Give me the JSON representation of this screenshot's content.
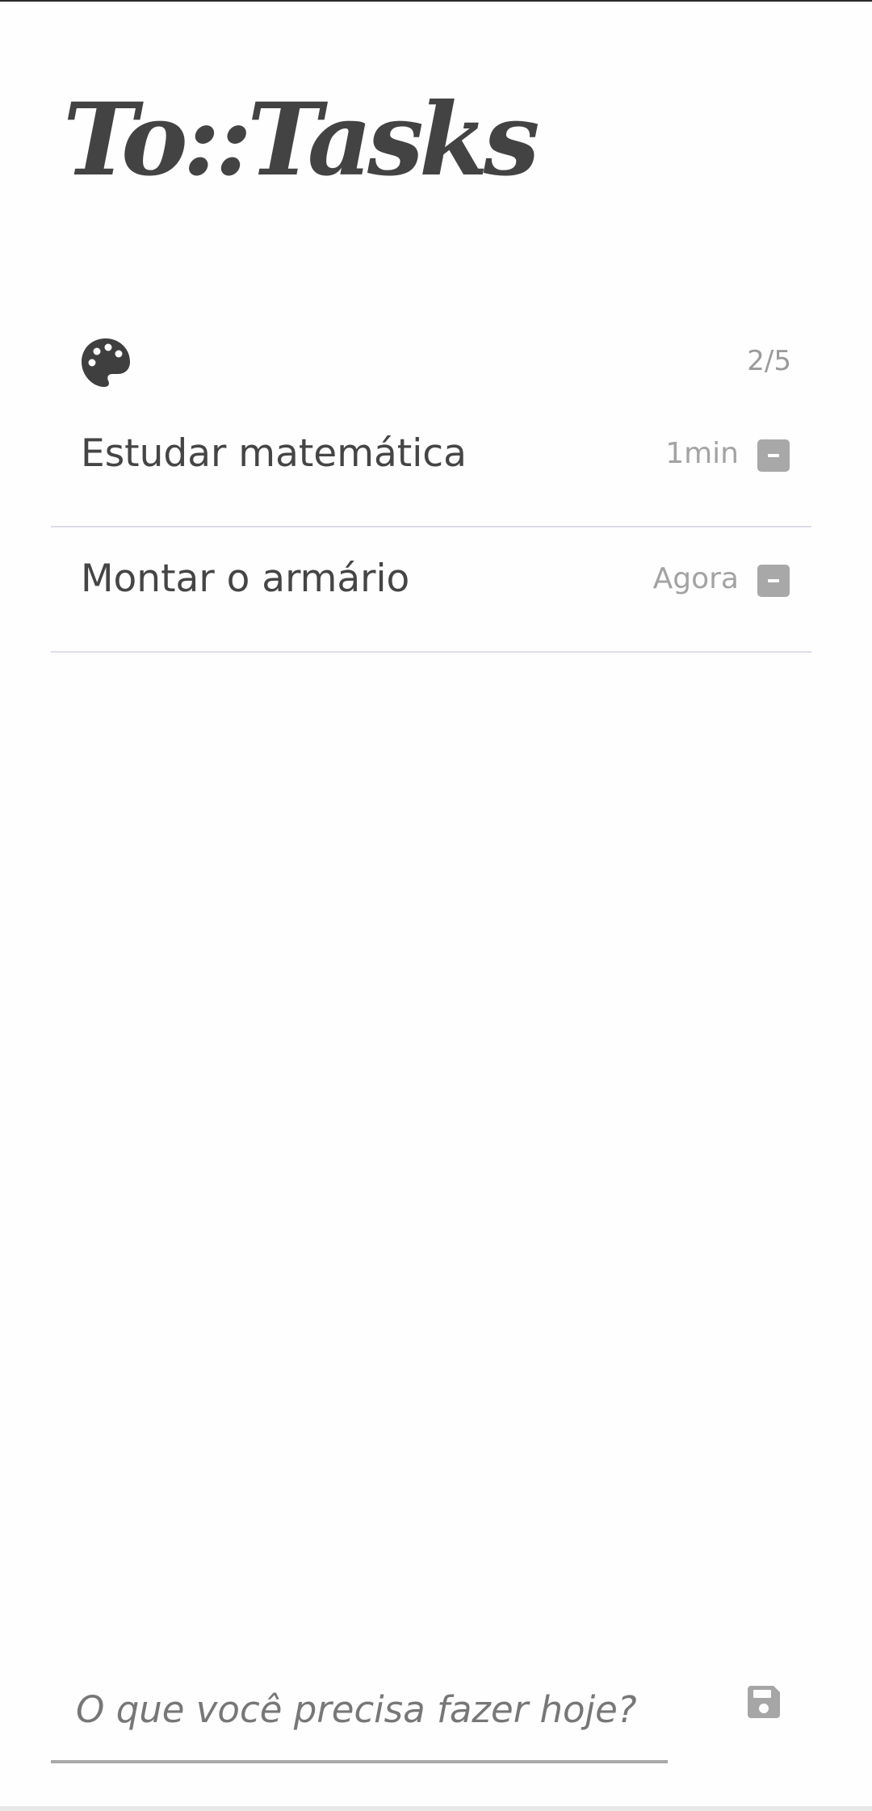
{
  "app": {
    "logo_text": "To::Tasks"
  },
  "header": {
    "theme_icon": "palette-icon",
    "counter": "2/5"
  },
  "tasks": [
    {
      "title": "Estudar matemática",
      "time": "1min",
      "action_icon": "minus-square-icon"
    },
    {
      "title": "Montar o armário",
      "time": "Agora",
      "action_icon": "minus-square-icon"
    }
  ],
  "new_task": {
    "placeholder": "O que você precisa fazer hoje?",
    "value": "",
    "save_icon": "floppy-disk-icon"
  },
  "colors": {
    "text": "#444444",
    "muted": "#a3a3a3",
    "button": "#a8a8a8",
    "divider": "#dcdde8",
    "background": "#fefefe"
  }
}
